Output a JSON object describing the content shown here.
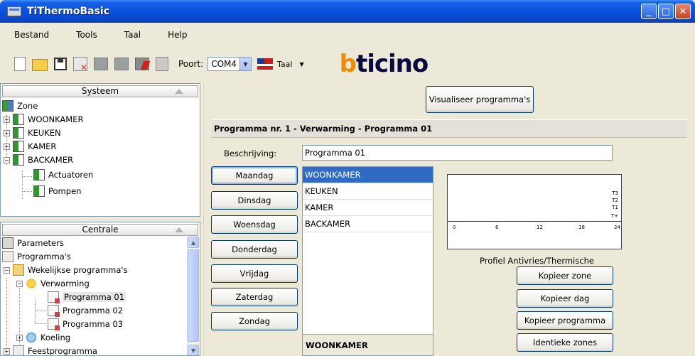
{
  "window": {
    "title": "TiThermoBasic"
  },
  "menu": [
    "Bestand",
    "Tools",
    "Taal",
    "Help"
  ],
  "toolbar": {
    "poort_label": "Poort:",
    "poort_value": "COM4",
    "taal_label": "Taal",
    "logo_b": "b",
    "logo_rest": "ticino"
  },
  "systeem": {
    "header": "Systeem",
    "root": "Zone",
    "zones": [
      "WOONKAMER",
      "KEUKEN",
      "KAMER",
      "BACKAMER"
    ],
    "children": [
      "Actuatoren",
      "Pompen"
    ]
  },
  "centrale": {
    "header": "Centrale",
    "items": {
      "parameters": "Parameters",
      "programmas": "Programma's",
      "wekelijkse": "Wekelijkse programma's",
      "verwarming": "Verwarming",
      "prog1": "Programma 01",
      "prog2": "Programma 02",
      "prog3": "Programma 03",
      "koeling": "Koeling",
      "feest": "Feestprogramma"
    }
  },
  "main": {
    "visualise_button": "Visualiseer programma's",
    "section_title": "Programma nr. 1 - Verwarming - Programma 01",
    "desc_label": "Beschrijving:",
    "desc_value": "Programma 01",
    "days": [
      "Maandag",
      "Dinsdag",
      "Woensdag",
      "Donderdag",
      "Vrijdag",
      "Zaterdag",
      "Zondag"
    ],
    "zone_list": [
      "WOONKAMER",
      "KEUKEN",
      "KAMER",
      "BACKAMER"
    ],
    "selected_zone_footer": "WOONKAMER",
    "graph_x_ticks": [
      "0",
      "6",
      "12",
      "18",
      "24"
    ],
    "graph_levels": [
      "T3",
      "T2",
      "T1",
      "T+"
    ],
    "profile_label": "Profiel  Antivries/Thermische",
    "actions": [
      "Kopieer zone",
      "Kopieer dag",
      "Kopieer programma",
      "Identieke zones"
    ]
  }
}
